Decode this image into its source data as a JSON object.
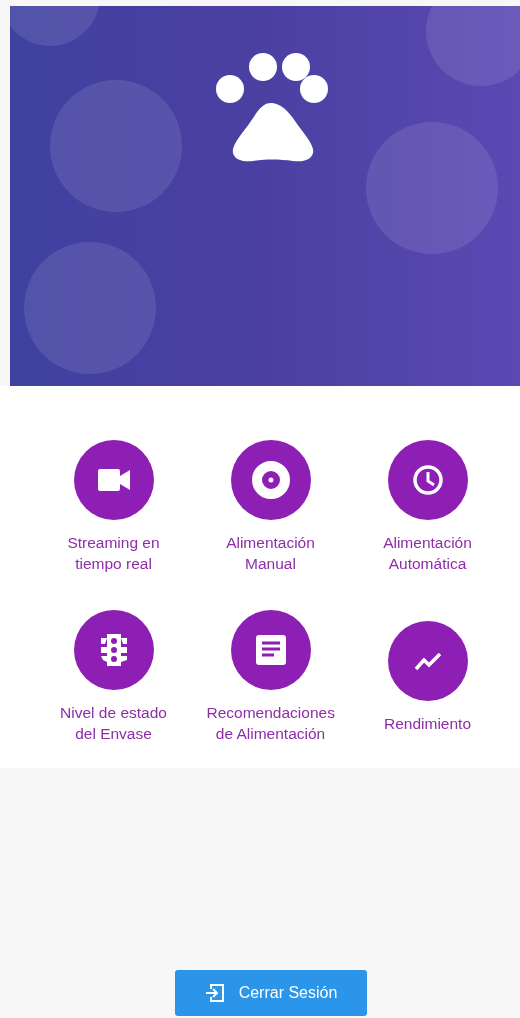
{
  "menu": [
    {
      "label": "Streaming en tiempo real",
      "kind": "video"
    },
    {
      "label": "Alimentación Manual",
      "kind": "disc"
    },
    {
      "label": "Alimentación Automática",
      "kind": "clock"
    },
    {
      "label": "Nivel de estado del Envase",
      "kind": "traffic"
    },
    {
      "label": "Recomendaciones de Alimentación",
      "kind": "document"
    },
    {
      "label": "Rendimiento",
      "kind": "trend"
    }
  ],
  "logout_button": {
    "label": "Cerrar Sesión"
  }
}
